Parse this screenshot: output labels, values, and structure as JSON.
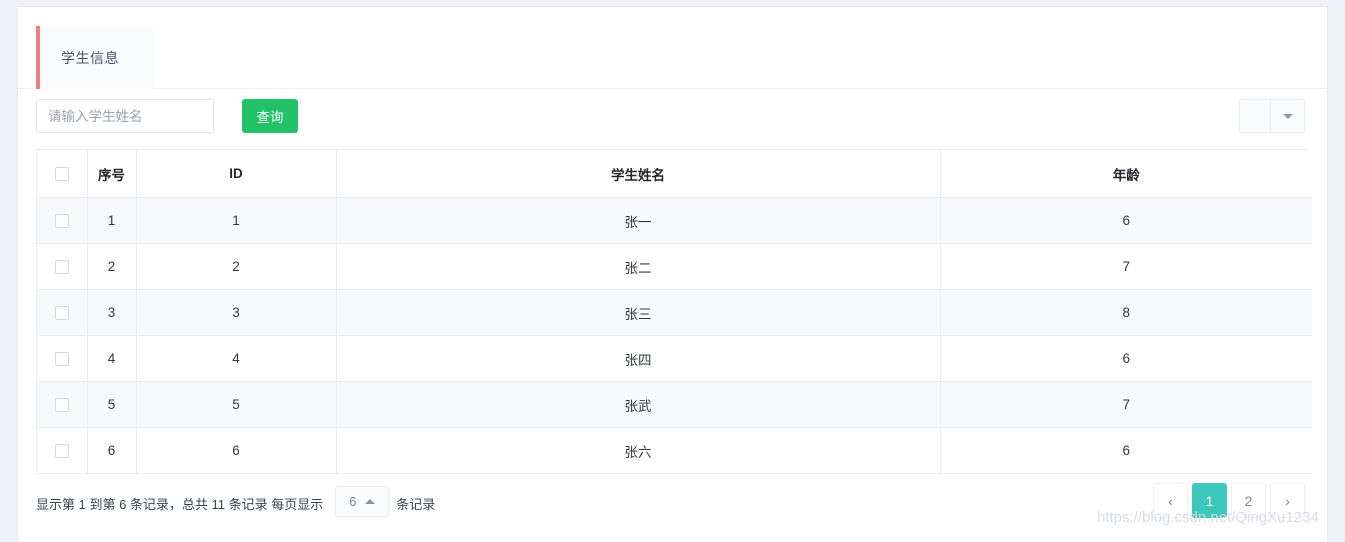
{
  "panel": {
    "title": "学生信息",
    "accent_color": "#ef7e7e"
  },
  "toolbar": {
    "search_placeholder": "请输入学生姓名",
    "search_value": "",
    "search_button_label": "查询",
    "search_button_color": "#22c368",
    "columns_button_label": "",
    "dropdown_icon": "caret-down-icon"
  },
  "table": {
    "columns": [
      "",
      "序号",
      "ID",
      "学生姓名",
      "年龄"
    ],
    "rows": [
      {
        "index": "1",
        "id": "1",
        "name": "张一",
        "age": "6"
      },
      {
        "index": "2",
        "id": "2",
        "name": "张二",
        "age": "7"
      },
      {
        "index": "3",
        "id": "3",
        "name": "张三",
        "age": "8"
      },
      {
        "index": "4",
        "id": "4",
        "name": "张四",
        "age": "6"
      },
      {
        "index": "5",
        "id": "5",
        "name": "张武",
        "age": "7"
      },
      {
        "index": "6",
        "id": "6",
        "name": "张六",
        "age": "6"
      }
    ]
  },
  "footer": {
    "info_prefix": "显示第 1 到第 6 条记录，总共 11 条记录 每页显示",
    "page_size": "6",
    "page_size_icon": "caret-up-icon",
    "info_suffix": "条记录",
    "pagination": [
      {
        "label": "‹",
        "name": "pagination-prev",
        "active": false
      },
      {
        "label": "1",
        "name": "pagination-page-1",
        "active": true
      },
      {
        "label": "2",
        "name": "pagination-page-2",
        "active": false
      },
      {
        "label": "›",
        "name": "pagination-next",
        "active": false
      }
    ],
    "active_page_color": "#3cc8bd"
  },
  "watermark": {
    "text": "https://blog.csdn.net/QingXu1234"
  }
}
